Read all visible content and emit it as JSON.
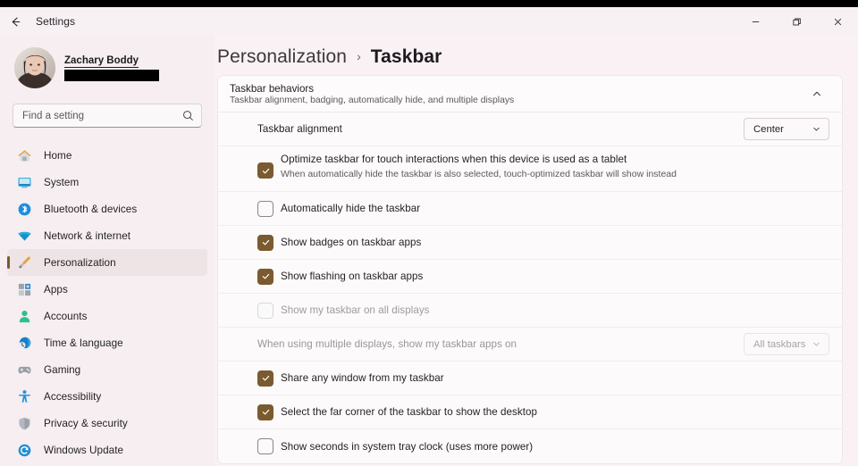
{
  "window": {
    "app_title": "Settings",
    "back_icon": "back-arrow-icon",
    "controls": {
      "minimize": "minimize-icon",
      "restore": "restore-icon",
      "close": "close-icon"
    }
  },
  "accent_color": "#7a5a2e",
  "sidebar": {
    "account": {
      "name": "Zachary Boddy",
      "email_redacted": true
    },
    "search": {
      "placeholder": "Find a setting",
      "value": "",
      "icon": "search-icon"
    },
    "items": [
      {
        "label": "Home",
        "icon": "home-icon",
        "selected": false
      },
      {
        "label": "System",
        "icon": "system-monitor-icon",
        "selected": false
      },
      {
        "label": "Bluetooth & devices",
        "icon": "bluetooth-icon",
        "selected": false
      },
      {
        "label": "Network & internet",
        "icon": "wifi-icon",
        "selected": false
      },
      {
        "label": "Personalization",
        "icon": "paintbrush-icon",
        "selected": true
      },
      {
        "label": "Apps",
        "icon": "apps-grid-icon",
        "selected": false
      },
      {
        "label": "Accounts",
        "icon": "person-icon",
        "selected": false
      },
      {
        "label": "Time & language",
        "icon": "clock-globe-icon",
        "selected": false
      },
      {
        "label": "Gaming",
        "icon": "gamepad-icon",
        "selected": false
      },
      {
        "label": "Accessibility",
        "icon": "accessibility-person-icon",
        "selected": false
      },
      {
        "label": "Privacy & security",
        "icon": "shield-icon",
        "selected": false
      },
      {
        "label": "Windows Update",
        "icon": "update-refresh-icon",
        "selected": false
      }
    ]
  },
  "breadcrumb": {
    "parent": "Personalization",
    "separator": "›",
    "current": "Taskbar"
  },
  "card": {
    "header": {
      "title": "Taskbar behaviors",
      "subtitle": "Taskbar alignment, badging, automatically hide, and multiple displays",
      "expanded": true,
      "chevron_icon": "chevron-up-icon"
    },
    "rows": [
      {
        "type": "dropdown",
        "label": "Taskbar alignment",
        "value": "Center",
        "disabled": false
      },
      {
        "type": "checkbox-with-description",
        "label": "Optimize taskbar for touch interactions when this device is used as a tablet",
        "description": "When automatically hide the taskbar is also selected, touch-optimized taskbar will show instead",
        "checked": true,
        "disabled": false
      },
      {
        "type": "checkbox",
        "label": "Automatically hide the taskbar",
        "checked": false,
        "disabled": false
      },
      {
        "type": "checkbox",
        "label": "Show badges on taskbar apps",
        "checked": true,
        "disabled": false
      },
      {
        "type": "checkbox",
        "label": "Show flashing on taskbar apps",
        "checked": true,
        "disabled": false
      },
      {
        "type": "checkbox",
        "label": "Show my taskbar on all displays",
        "checked": false,
        "disabled": true
      },
      {
        "type": "dropdown",
        "label": "When using multiple displays, show my taskbar apps on",
        "value": "All taskbars",
        "disabled": true
      },
      {
        "type": "checkbox",
        "label": "Share any window from my taskbar",
        "checked": true,
        "disabled": false
      },
      {
        "type": "checkbox",
        "label": "Select the far corner of the taskbar to show the desktop",
        "checked": true,
        "disabled": false
      },
      {
        "type": "checkbox",
        "label": "Show seconds in system tray clock (uses more power)",
        "checked": false,
        "disabled": false
      }
    ]
  }
}
